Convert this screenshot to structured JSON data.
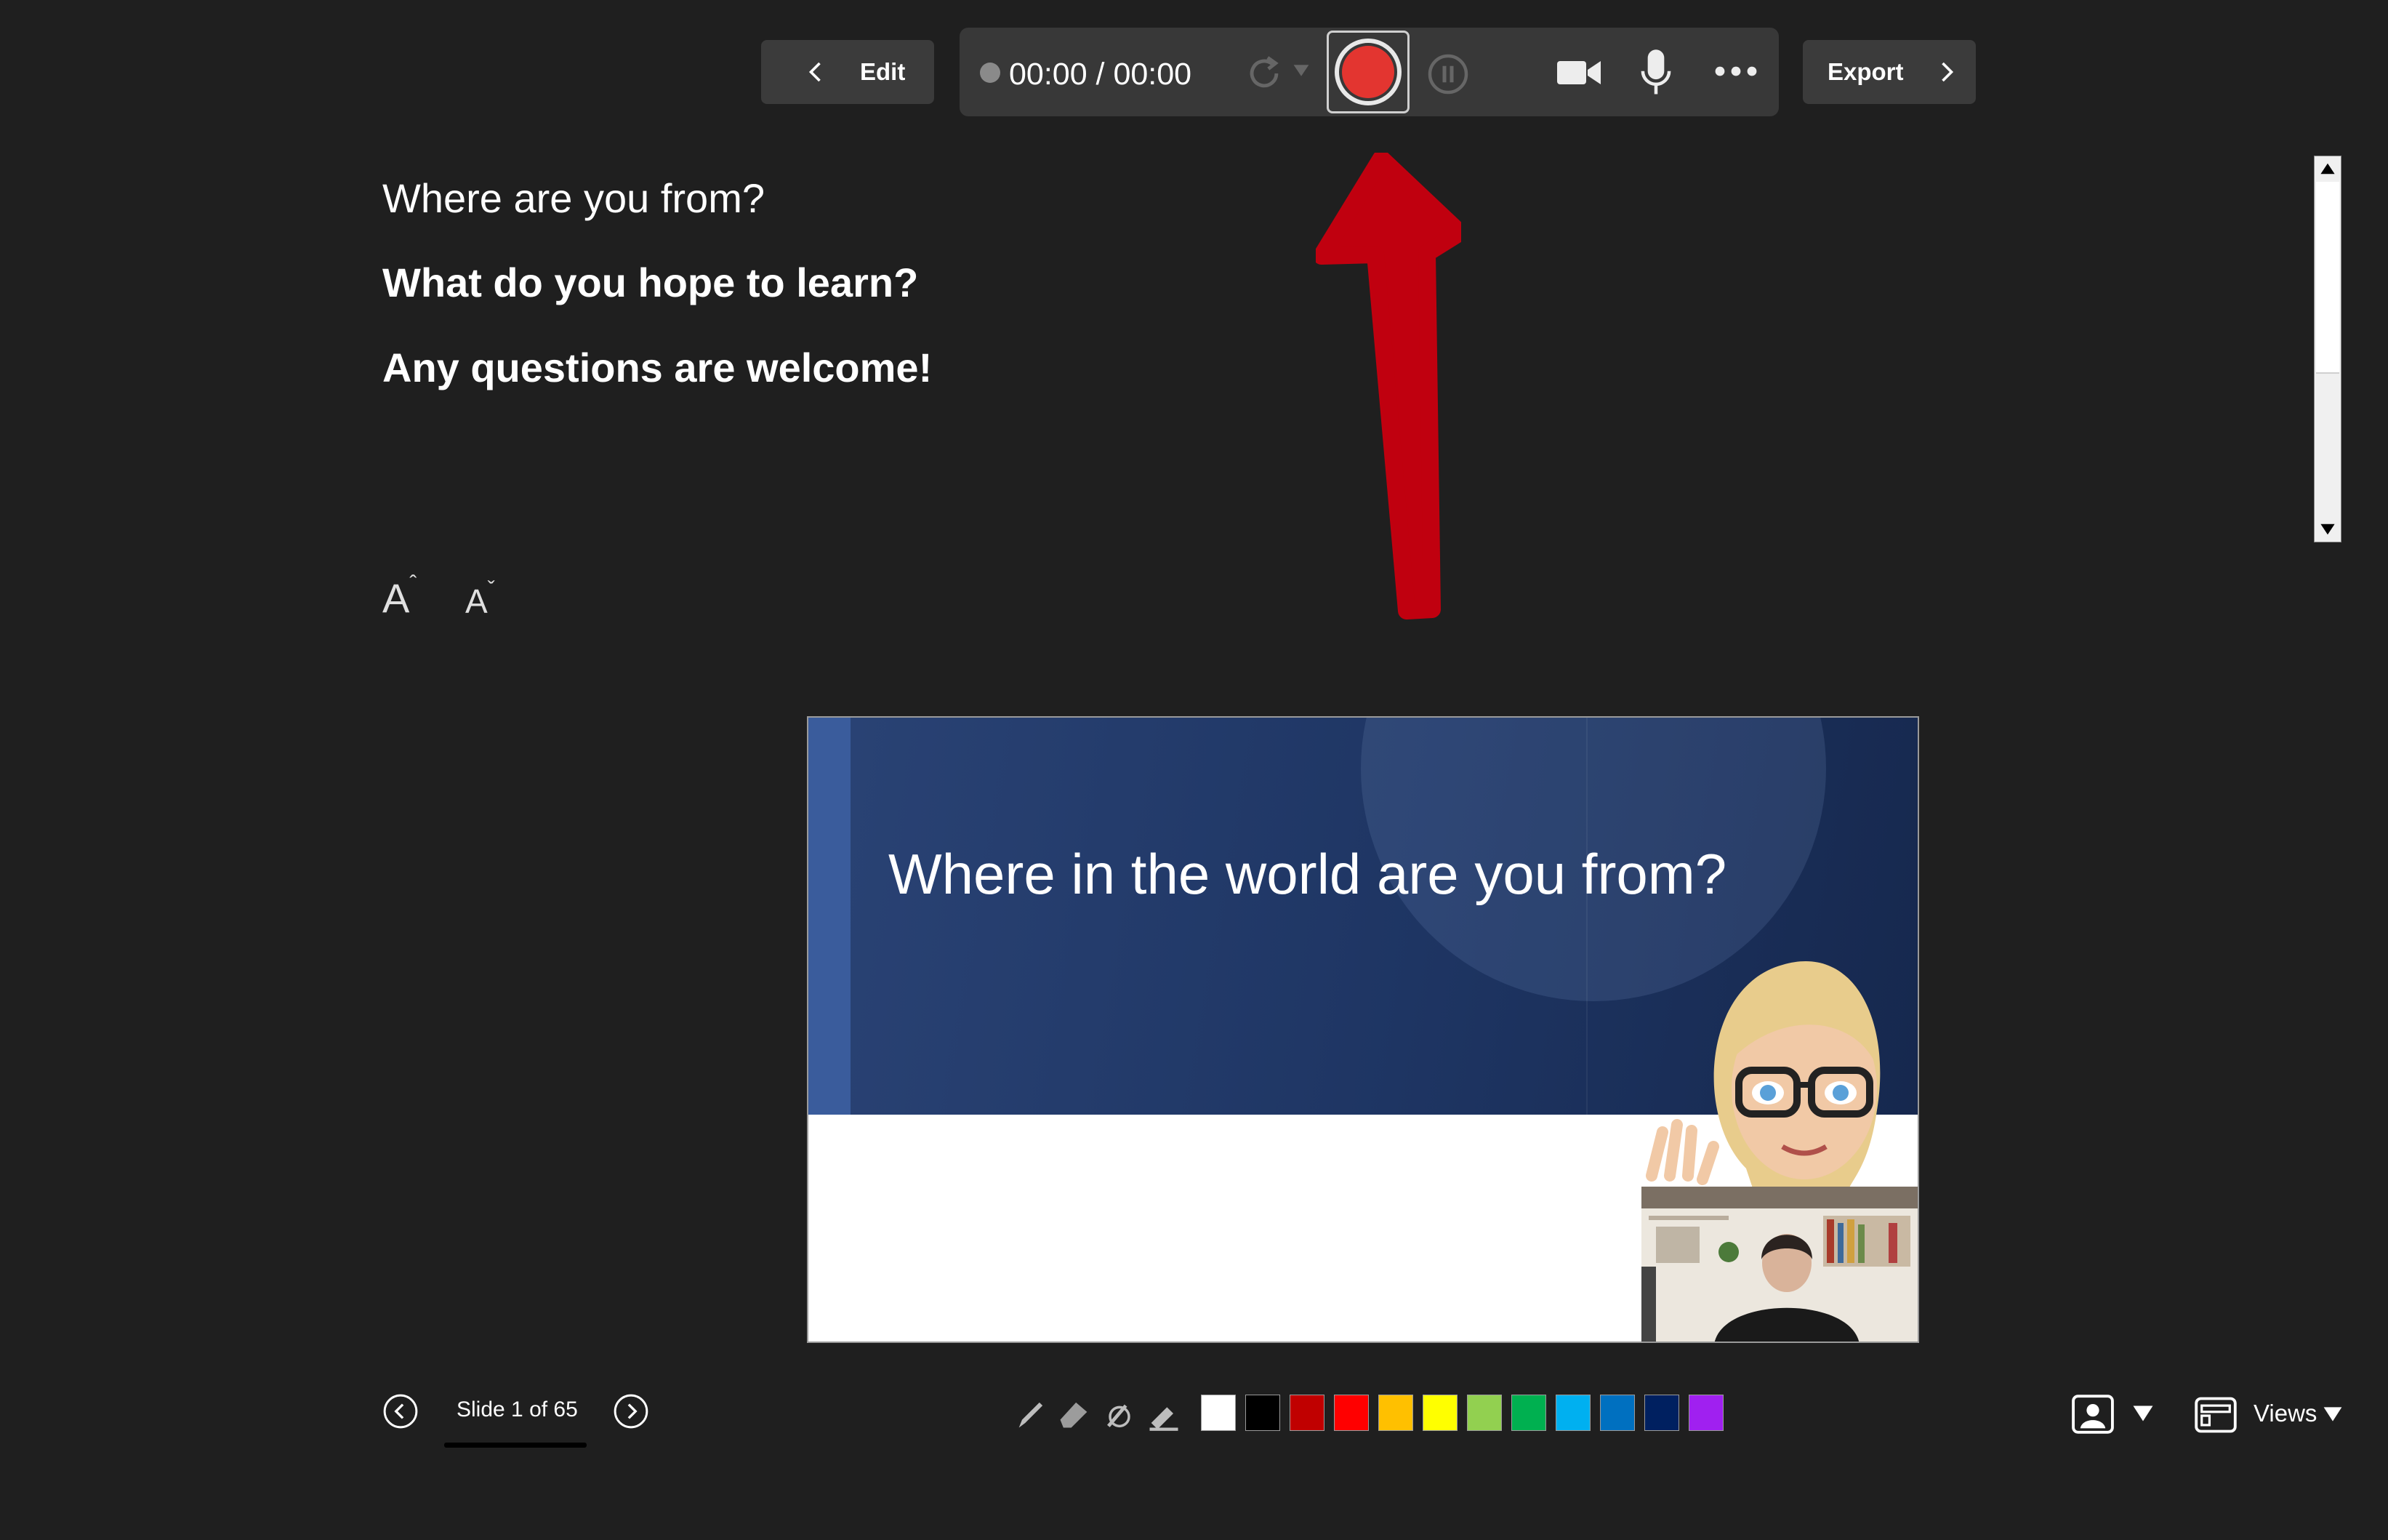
{
  "toolbar": {
    "edit_label": "Edit",
    "timer": "00:00 / 00:00",
    "export_label": "Export",
    "record_color": "#e33530"
  },
  "notes": {
    "lines": [
      "Where are you from?",
      "What do you hope to learn?",
      "Any questions are welcome!"
    ],
    "increase_font_label": "A",
    "decrease_font_label": "A"
  },
  "slide": {
    "title": "Where in the world are you from?"
  },
  "navigation": {
    "counter": "Slide 1 of 65"
  },
  "ink": {
    "tools": [
      "pen-icon",
      "eraser-icon",
      "laser-pointer-icon",
      "highlighter-icon"
    ],
    "colors": [
      "#ffffff",
      "#000000",
      "#c00000",
      "#ff0000",
      "#ffc000",
      "#ffff00",
      "#92d050",
      "#00b050",
      "#00b0f0",
      "#0070c0",
      "#002060",
      "#a020f0"
    ]
  },
  "views": {
    "label": "Views"
  },
  "annotation": {
    "arrow_color": "#c0000f"
  }
}
